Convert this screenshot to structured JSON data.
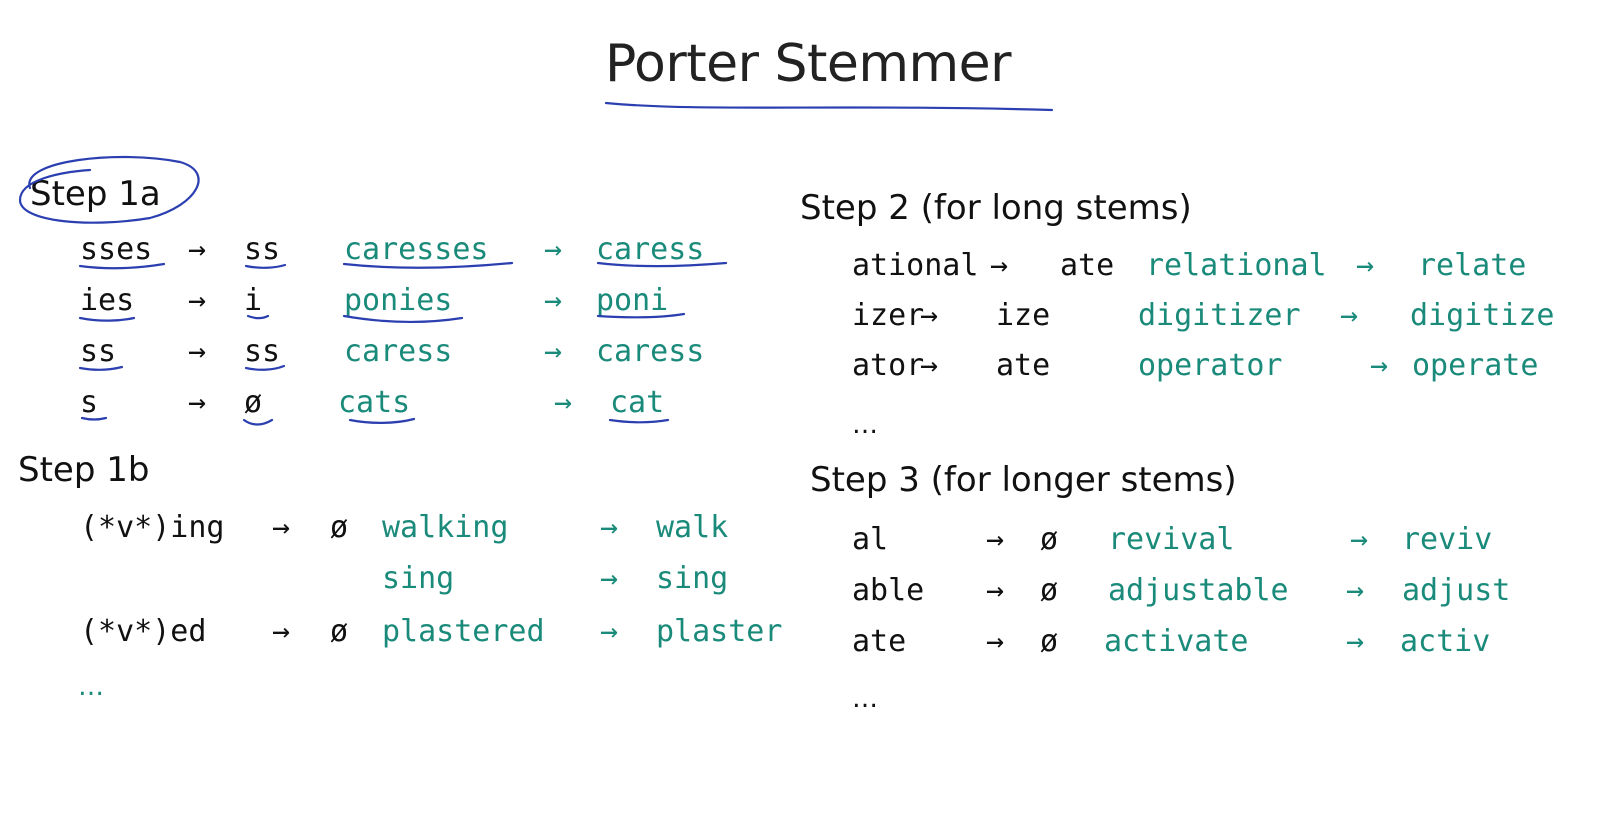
{
  "title": "Porter Stemmer",
  "arrow": "→",
  "step1a": {
    "heading": "Step 1a",
    "rows": [
      {
        "suffix": "sses",
        "replacement": "ss",
        "example": "caresses",
        "result": "caress"
      },
      {
        "suffix": "ies",
        "replacement": "i",
        "example": "ponies",
        "result": "poni"
      },
      {
        "suffix": "ss",
        "replacement": "ss",
        "example": "caress",
        "result": "caress"
      },
      {
        "suffix": "s",
        "replacement": "ø",
        "example": "cats",
        "result": "cat"
      }
    ]
  },
  "step1b": {
    "heading": "Step 1b",
    "rows": [
      {
        "suffix": "(*v*)ing",
        "replacement": "ø",
        "example": "walking",
        "result": "walk"
      },
      {
        "suffix": "",
        "replacement": "",
        "example": "sing",
        "result": "sing"
      },
      {
        "suffix": "(*v*)ed",
        "replacement": "ø",
        "example": "plastered",
        "result": "plaster"
      }
    ],
    "ellipsis": "…"
  },
  "step2": {
    "heading": "Step 2 (for long stems)",
    "rows": [
      {
        "suffix": "ational",
        "replacement": "ate",
        "example": "relational",
        "result": "relate"
      },
      {
        "suffix": "izer",
        "replacement": "ize",
        "example": "digitizer",
        "result": "digitize"
      },
      {
        "suffix": "ator",
        "replacement": "ate",
        "example": "operator",
        "result": "operate"
      }
    ],
    "ellipsis": "…"
  },
  "step3": {
    "heading": "Step 3 (for longer stems)",
    "rows": [
      {
        "suffix": "al",
        "replacement": "ø",
        "example": "revival",
        "result": "reviv"
      },
      {
        "suffix": "able",
        "replacement": "ø",
        "example": "adjustable",
        "result": "adjust"
      },
      {
        "suffix": "ate",
        "replacement": "ø",
        "example": "activate",
        "result": "activ"
      }
    ],
    "ellipsis": "…"
  },
  "colors": {
    "example_text": "#1a8a7a",
    "annotation_ink": "#2b3fb0",
    "background": "#ffffff"
  }
}
